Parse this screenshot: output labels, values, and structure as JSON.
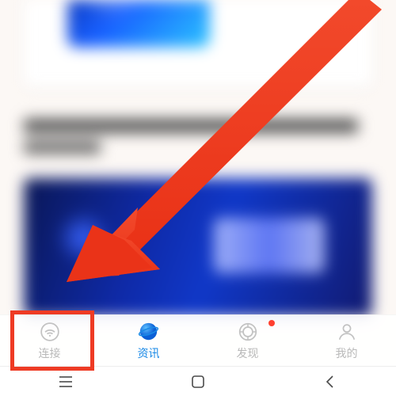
{
  "tabs": {
    "connect": {
      "label": "连接",
      "icon": "wifi-icon"
    },
    "news": {
      "label": "资讯",
      "icon": "globe-icon"
    },
    "discover": {
      "label": "发现",
      "icon": "discover-icon",
      "badge": true
    },
    "me": {
      "label": "我的",
      "icon": "person-icon"
    }
  },
  "active_tab": "news",
  "annotation": {
    "arrow_color": "#ee3b24",
    "highlight_target": "connect"
  },
  "colors": {
    "accent": "#1989e6",
    "inactive": "#b9b9b9",
    "badge": "#ff4030"
  }
}
